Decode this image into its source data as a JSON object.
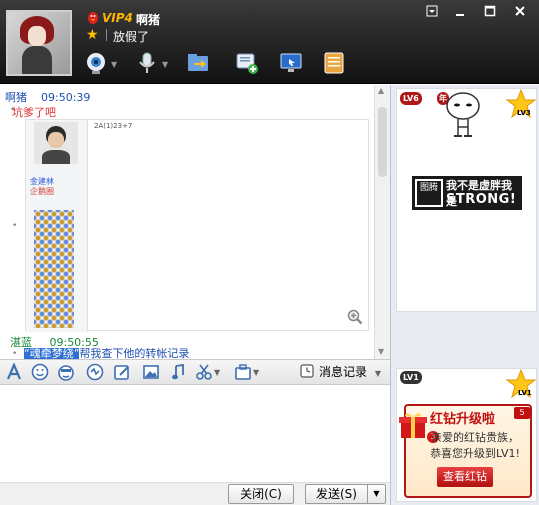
{
  "header": {
    "vip_label": "VIP4",
    "nickname": "啊猪",
    "status": "放假了",
    "window_buttons": [
      "menu",
      "skin",
      "minimize",
      "maximize",
      "close"
    ]
  },
  "toolbar": {
    "items": [
      {
        "name": "video-call-icon",
        "has_dropdown": true
      },
      {
        "name": "voice-call-icon",
        "has_dropdown": true
      },
      {
        "name": "send-file-icon",
        "has_dropdown": false
      },
      {
        "name": "create-discussion-icon",
        "has_dropdown": false
      },
      {
        "name": "remote-assistance-icon",
        "has_dropdown": false
      },
      {
        "name": "apps-icon",
        "has_dropdown": false
      }
    ]
  },
  "chat": {
    "messages": [
      {
        "sender": "啊猪",
        "time": "09:50:39",
        "text": "坑爹了吧"
      },
      {
        "sender": "湛蓝",
        "time": "09:50:55",
        "highlight": "“魂牵梦绕”",
        "text": "帮我查下他的转帐记录"
      }
    ],
    "screenshot": {
      "profile_name": "金建林",
      "profile_signature": "企鹅圈",
      "text": "2A(1)23+7"
    }
  },
  "format_toolbar": {
    "icons": [
      "font-icon",
      "emoji-icon",
      "magic-emoji-icon",
      "vibrate-icon",
      "handwrite-icon",
      "image-icon",
      "music-icon",
      "screenshot-icon",
      "scene-icon"
    ],
    "history_label": "消息记录"
  },
  "buttons": {
    "close_label": "关闭(C)",
    "send_label": "发送(S)"
  },
  "ads": {
    "top": {
      "level_badge": "LV6",
      "year_badge": "年",
      "star_level": "LV3",
      "slogan_cn": "我不是虚胖我是",
      "slogan_en": "STRONG!",
      "seal_text": "图腾"
    },
    "bottom": {
      "level_badge": "LV1",
      "star_level": "LV1",
      "title": "红钻升级啦",
      "gift_count": "3",
      "corner_badge": "5",
      "body_line1": "亲爱的红钻贵族，",
      "body_line2": "恭喜您升级到LV1!",
      "button": "查看红钻"
    }
  },
  "colors": {
    "header_bg": "#1a1a1a",
    "vip": "#ffb400",
    "sender_self": "#1e50b3",
    "sender_other": "#1a8a3a",
    "alert_red": "#c01010"
  }
}
